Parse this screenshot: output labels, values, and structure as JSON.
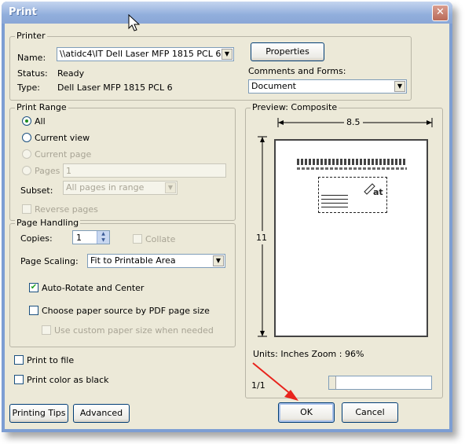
{
  "window": {
    "title": "Print",
    "close_glyph": "✕"
  },
  "printer": {
    "group_label": "Printer",
    "name_label": "Name:",
    "name_value": "\\\\atidc4\\IT Dell Laser MFP 1815 PCL 6",
    "properties_button": "Properties",
    "status_label": "Status:",
    "status_value": "Ready",
    "type_label": "Type:",
    "type_value": "Dell Laser MFP 1815 PCL 6",
    "comments_label": "Comments and Forms:",
    "comments_value": "Document"
  },
  "print_range": {
    "group_label": "Print Range",
    "all": "All",
    "current_view": "Current view",
    "current_page": "Current page",
    "pages": "Pages",
    "pages_value": "1",
    "subset_label": "Subset:",
    "subset_value": "All pages in range",
    "reverse_pages": "Reverse pages",
    "selected": "All"
  },
  "page_handling": {
    "group_label": "Page Handling",
    "copies_label": "Copies:",
    "copies_value": "1",
    "collate": "Collate",
    "scaling_label": "Page Scaling:",
    "scaling_value": "Fit to Printable Area",
    "auto_rotate": "Auto-Rotate and Center",
    "auto_rotate_checked": true,
    "choose_source": "Choose paper source by PDF page size",
    "choose_source_checked": false,
    "custom_size": "Use custom paper size when needed"
  },
  "options": {
    "print_to_file": "Print to file",
    "print_color_black": "Print color as black"
  },
  "preview": {
    "group_label": "Preview: Composite",
    "width_label": "8.5",
    "height_label": "11",
    "units_text": "Units: Inches Zoom :  96%",
    "page_indicator": "1/1"
  },
  "buttons": {
    "printing_tips": "Printing Tips",
    "advanced": "Advanced",
    "ok": "OK",
    "cancel": "Cancel"
  },
  "colors": {
    "annotation_arrow": "#e8231c",
    "titlebar": "#8aa7d6"
  }
}
